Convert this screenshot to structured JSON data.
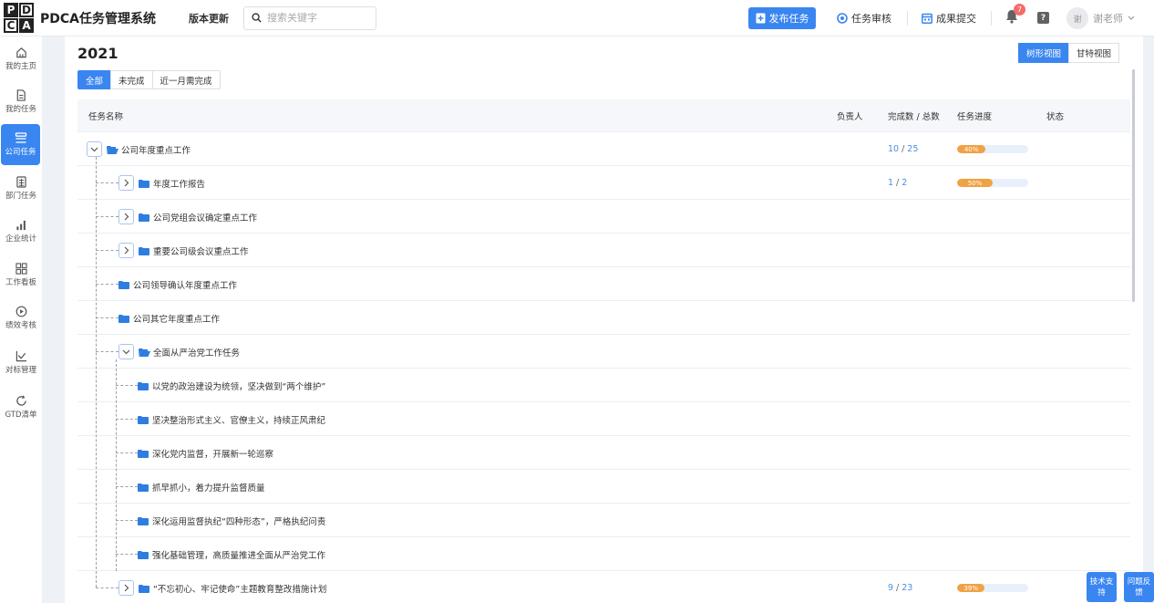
{
  "header": {
    "logo_letters": [
      "P",
      "D",
      "C",
      "A"
    ],
    "app_title": "PDCA任务管理系统",
    "version_label": "版本更新",
    "search_placeholder": "搜索关键字",
    "publish_label": "发布任务",
    "review_label": "任务审核",
    "submit_label": "成果提交",
    "notification_count": "7",
    "help_label": "?",
    "avatar_text": "谢",
    "user_name": "谢老师"
  },
  "sidebar": {
    "items": [
      {
        "label": "我的主页",
        "icon": "home-icon"
      },
      {
        "label": "我的任务",
        "icon": "document-icon"
      },
      {
        "label": "公司任务",
        "icon": "tree-list-icon",
        "active": true
      },
      {
        "label": "部门任务",
        "icon": "calculator-icon"
      },
      {
        "label": "企业统计",
        "icon": "bar-chart-icon"
      },
      {
        "label": "工作看板",
        "icon": "grid-icon"
      },
      {
        "label": "绩效考核",
        "icon": "target-icon"
      },
      {
        "label": "对标管理",
        "icon": "line-chart-icon"
      },
      {
        "label": "GTD清单",
        "icon": "refresh-icon"
      }
    ]
  },
  "main": {
    "year": "2021",
    "filters": [
      "全部",
      "未完成",
      "近一月需完成"
    ],
    "active_filter": "全部",
    "views": [
      "树形视图",
      "甘特视图"
    ],
    "active_view": "树形视图",
    "columns": {
      "name": "任务名称",
      "owner": "负责人",
      "count": "完成数 / 总数",
      "progress": "任务进度",
      "status": "状态"
    },
    "rows": [
      {
        "name": "公司年度重点工作",
        "level": 0,
        "toggle": "expanded",
        "done": "10",
        "total": "25",
        "progress": 0.4,
        "progress_label": "40%"
      },
      {
        "name": "年度工作报告",
        "level": 1,
        "toggle": "collapsed",
        "done": "1",
        "total": "2",
        "progress": 0.5,
        "progress_label": "50%"
      },
      {
        "name": "公司党组会议确定重点工作",
        "level": 1,
        "toggle": "collapsed"
      },
      {
        "name": "重要公司级会议重点工作",
        "level": 1,
        "toggle": "collapsed"
      },
      {
        "name": "公司领导确认年度重点工作",
        "level": 1,
        "toggle": "none"
      },
      {
        "name": "公司其它年度重点工作",
        "level": 1,
        "toggle": "none"
      },
      {
        "name": "全面从严治党工作任务",
        "level": 1,
        "toggle": "expanded"
      },
      {
        "name": "以党的政治建设为统领，坚决做到“两个维护”",
        "level": 2,
        "toggle": "none"
      },
      {
        "name": "坚决整治形式主义、官僚主义，持续正风肃纪",
        "level": 2,
        "toggle": "none"
      },
      {
        "name": "深化党内监督，开展新一轮巡察",
        "level": 2,
        "toggle": "none"
      },
      {
        "name": "抓早抓小，着力提升监督质量",
        "level": 2,
        "toggle": "none"
      },
      {
        "name": "深化运用监督执纪“四种形态”，严格执纪问责",
        "level": 2,
        "toggle": "none"
      },
      {
        "name": "强化基础管理，高质量推进全面从严治党工作",
        "level": 2,
        "toggle": "none"
      },
      {
        "name": "“不忘初心、牢记使命”主题教育整改措施计划",
        "level": 1,
        "toggle": "collapsed",
        "done": "9",
        "total": "23",
        "progress": 0.39,
        "progress_label": "39%"
      }
    ]
  },
  "float_buttons": [
    "技术支持",
    "问题反馈"
  ],
  "colors": {
    "accent": "#3a86f0",
    "progress": "#f0a244",
    "folder": "#2f7de1"
  }
}
